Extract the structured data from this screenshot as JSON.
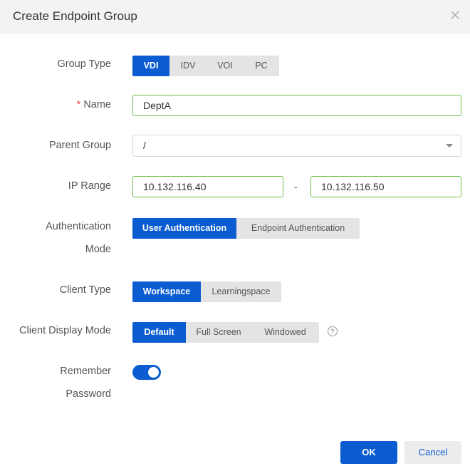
{
  "dialog": {
    "title": "Create Endpoint Group",
    "close_icon": "close-icon"
  },
  "form": {
    "group_type": {
      "label": "Group Type",
      "options": [
        "VDI",
        "IDV",
        "VOI",
        "PC"
      ],
      "selected": "VDI"
    },
    "name": {
      "required_mark": "*",
      "label": "Name",
      "value": "DeptA"
    },
    "parent_group": {
      "label": "Parent Group",
      "value": "/"
    },
    "ip_range": {
      "label": "IP Range",
      "start": "10.132.116.40",
      "separator": "-",
      "end": "10.132.116.50"
    },
    "auth_mode": {
      "label_line1": "Authentication",
      "label_line2": "Mode",
      "options": [
        "User Authentication",
        "Endpoint Authentication"
      ],
      "selected": "User Authentication"
    },
    "client_type": {
      "label": "Client Type",
      "options": [
        "Workspace",
        "Learningspace"
      ],
      "selected": "Workspace"
    },
    "client_display_mode": {
      "label": "Client Display Mode",
      "options": [
        "Default",
        "Full Screen",
        "Windowed"
      ],
      "selected": "Default",
      "help_icon": "help-circle-icon",
      "help_glyph": "?"
    },
    "remember_password": {
      "label_line1": "Remember",
      "label_line2": "Password",
      "enabled": true
    }
  },
  "footer": {
    "ok_label": "OK",
    "cancel_label": "Cancel"
  },
  "colors": {
    "primary": "#0a5cd0",
    "valid_border": "#6cc04a",
    "required": "#e5413b",
    "header_bg": "#f3f3f3"
  }
}
